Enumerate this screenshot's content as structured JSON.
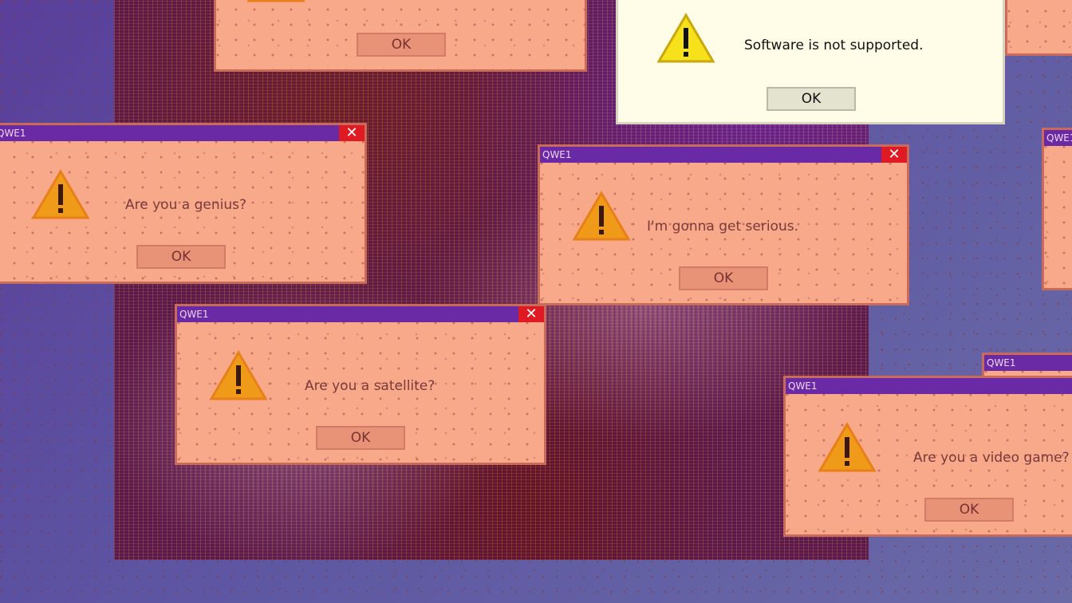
{
  "window_title": "QWE1",
  "close_glyph": "✕",
  "ok_label": "OK",
  "icons": {
    "warning": "warning-triangle-icon",
    "close": "close-icon"
  },
  "colors": {
    "titlebar": "#6a2aa6",
    "window_bg": "#f7a98a",
    "close_bg": "#e01a22",
    "cream_bg": "#fffde8"
  },
  "dialogs": [
    {
      "message": ""
    },
    {
      "message": "Software is not supported."
    },
    {
      "message": "Are you a genius?"
    },
    {
      "message": "I'm gonna get serious."
    },
    {
      "message": "Are you a satellite?"
    },
    {
      "message": "Are you a video game?"
    }
  ]
}
